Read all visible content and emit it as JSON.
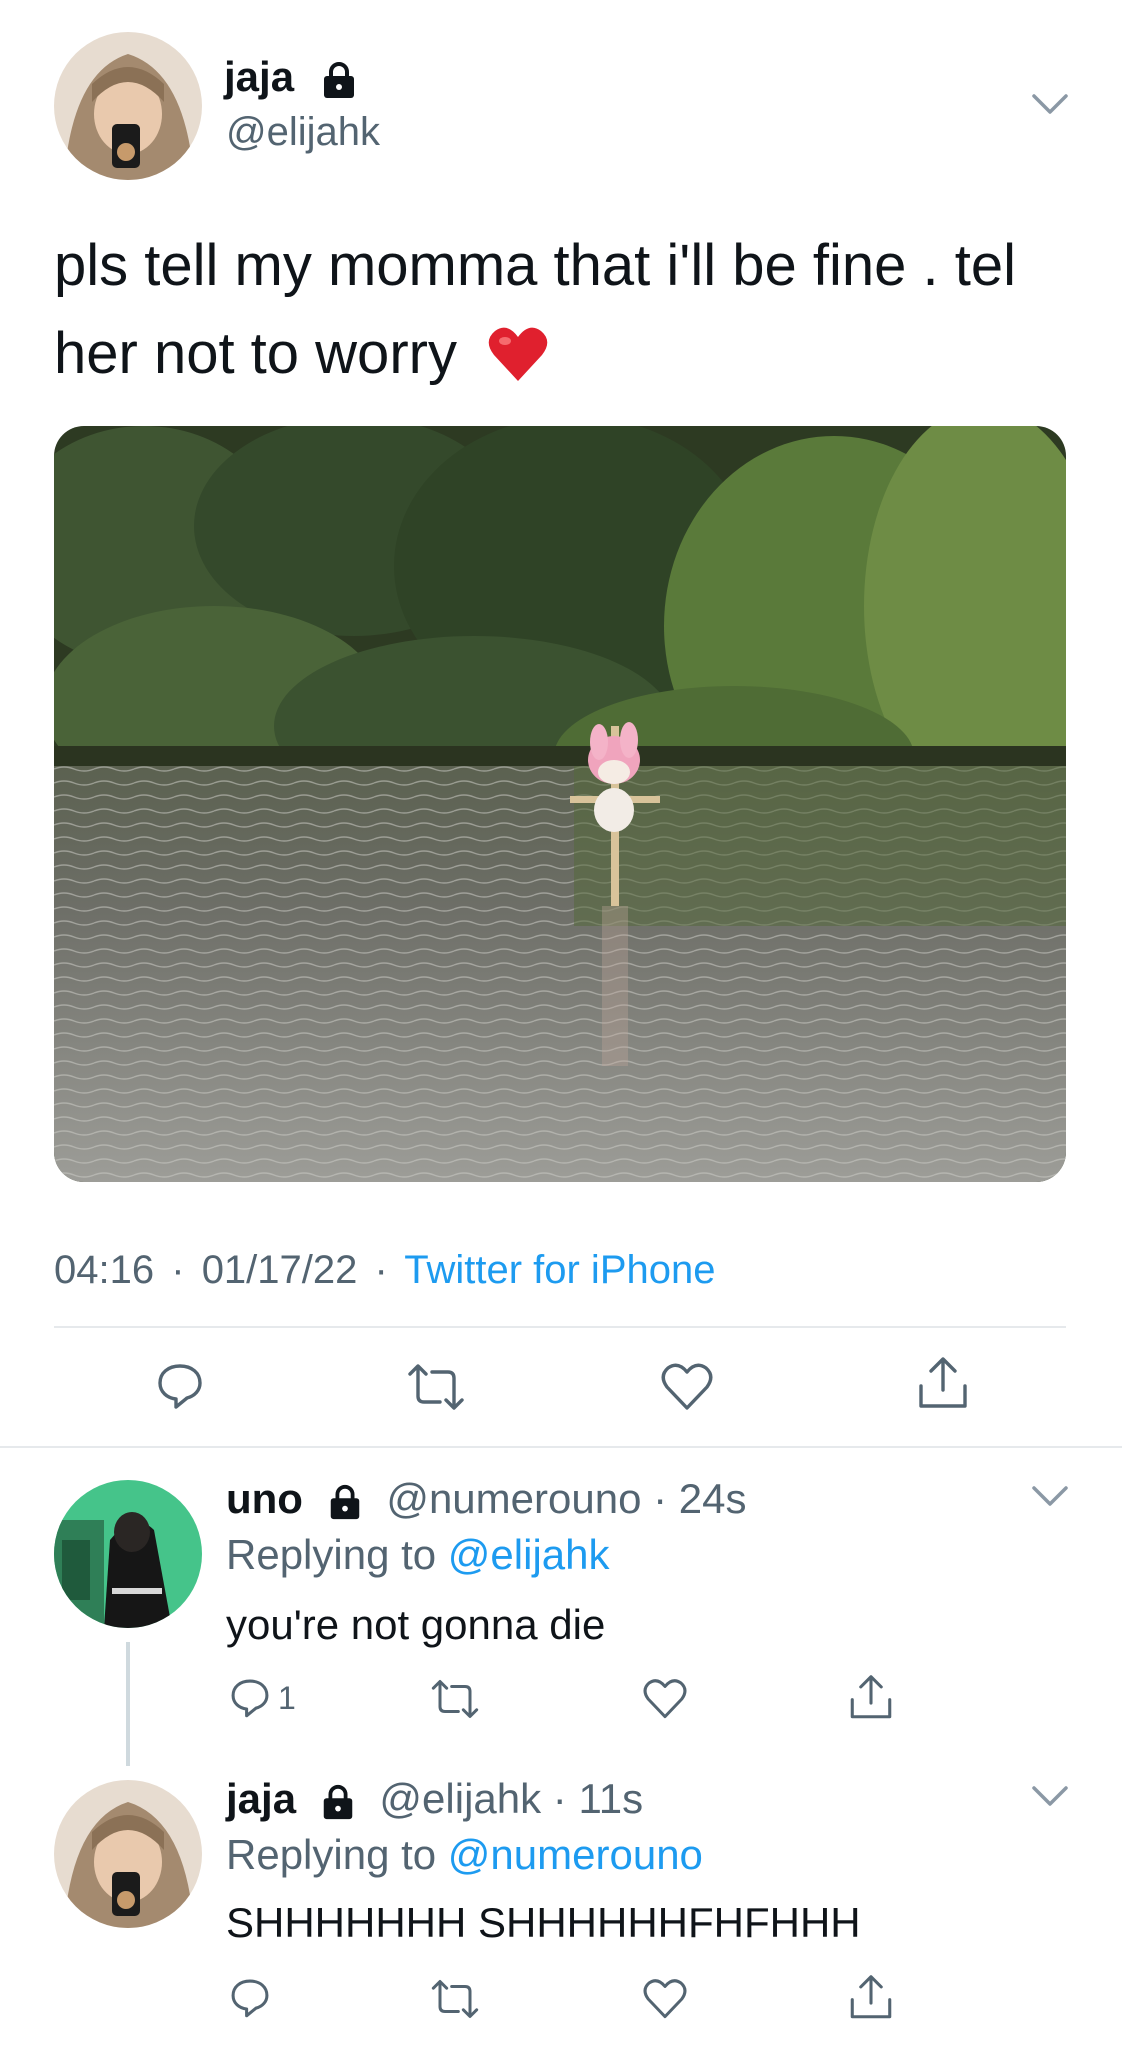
{
  "tweet": {
    "author_name": "jaja",
    "author_handle": "@elijahk",
    "text_line1": "pls tell my momma that i'll be fine . tel",
    "text_line2": "her not to worry",
    "emoji": "❤️",
    "time": "04:16",
    "date": "01/17/22",
    "separator": "·",
    "source": "Twitter for iPhone"
  },
  "replies": [
    {
      "name": "uno",
      "handle": "@numerouno",
      "age": "24s",
      "replying_label": "Replying to",
      "replying_to": "@elijahk",
      "text": "you're not gonna die",
      "reply_count": "1"
    },
    {
      "name": "jaja",
      "handle": "@elijahk",
      "age": "11s",
      "replying_label": "Replying to",
      "replying_to": "@numerouno",
      "text": "SHHHHHHH SHHHHHHFHFHHH",
      "reply_count": ""
    }
  ],
  "icons": {
    "reply": "reply-bubble-icon",
    "retweet": "retweet-icon",
    "like": "heart-icon",
    "share": "share-icon",
    "more": "chevron-down-icon",
    "lock": "lock-icon"
  },
  "colors": {
    "link": "#1d9bf0",
    "muted": "#536471",
    "text": "#0f1419",
    "divider": "#e6e9ec"
  }
}
